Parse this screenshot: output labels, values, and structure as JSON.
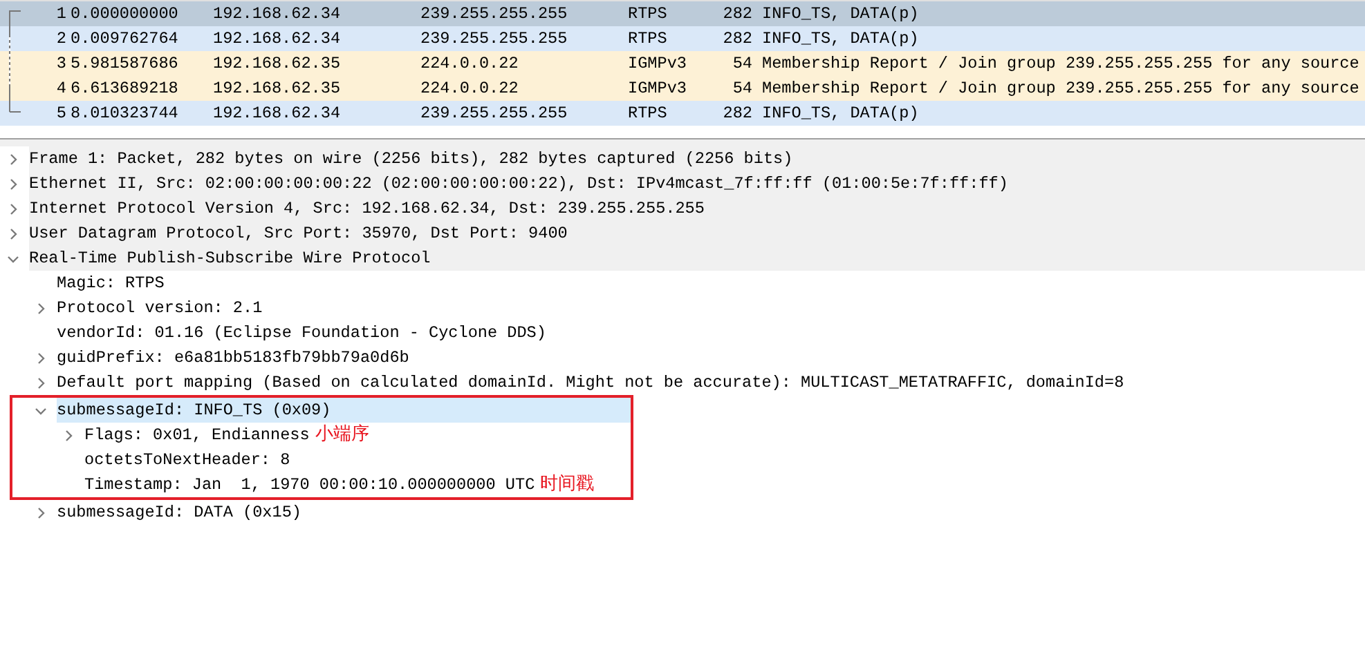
{
  "packet_list": {
    "rows": [
      {
        "no": "1",
        "time": "0.000000000",
        "source": "192.168.62.34",
        "destination": "239.255.255.255",
        "protocol": "RTPS",
        "length": "282",
        "info": "INFO_TS, DATA(p)",
        "selected": true
      },
      {
        "no": "2",
        "time": "0.009762764",
        "source": "192.168.62.34",
        "destination": "239.255.255.255",
        "protocol": "RTPS",
        "length": "282",
        "info": "INFO_TS, DATA(p)",
        "selected": false,
        "color": "#dae8f8"
      },
      {
        "no": "3",
        "time": "5.981587686",
        "source": "192.168.62.35",
        "destination": "224.0.0.22",
        "protocol": "IGMPv3",
        "length": "54",
        "info": "Membership Report / Join group 239.255.255.255 for any source",
        "selected": false,
        "color": "#fdf1d6"
      },
      {
        "no": "4",
        "time": "6.613689218",
        "source": "192.168.62.35",
        "destination": "224.0.0.22",
        "protocol": "IGMPv3",
        "length": "54",
        "info": "Membership Report / Join group 239.255.255.255 for any source",
        "selected": false,
        "color": "#fdf1d6"
      },
      {
        "no": "5",
        "time": "8.010323744",
        "source": "192.168.62.34",
        "destination": "239.255.255.255",
        "protocol": "RTPS",
        "length": "282",
        "info": "INFO_TS, DATA(p)",
        "selected": false,
        "color": "#dae8f8"
      }
    ]
  },
  "details": {
    "tree": [
      {
        "kind": "branch",
        "text": "Frame 1: Packet, 282 bytes on wire (2256 bits), 282 bytes captured (2256 bits)",
        "expanded": false,
        "selected": false
      },
      {
        "kind": "branch",
        "text": "Ethernet II, Src: 02:00:00:00:00:22 (02:00:00:00:00:22), Dst: IPv4mcast_7f:ff:ff (01:00:5e:7f:ff:ff)",
        "expanded": false,
        "selected": false
      },
      {
        "kind": "branch",
        "text": "Internet Protocol Version 4, Src: 192.168.62.34, Dst: 239.255.255.255",
        "expanded": false,
        "selected": false
      },
      {
        "kind": "branch",
        "text": "User Datagram Protocol, Src Port: 35970, Dst Port: 9400",
        "expanded": false,
        "selected": false
      },
      {
        "kind": "branch",
        "text": "Real-Time Publish-Subscribe Wire Protocol",
        "expanded": true,
        "selected": false,
        "children": [
          {
            "kind": "leaf",
            "text": "Magic: RTPS",
            "selected": false
          },
          {
            "kind": "branch",
            "text": "Protocol version: 2.1",
            "expanded": false,
            "selected": false
          },
          {
            "kind": "leaf",
            "text": "vendorId: 01.16 (Eclipse Foundation - Cyclone DDS)",
            "selected": false
          },
          {
            "kind": "branch",
            "text": "guidPrefix: e6a81bb5183fb79bb79a0d6b",
            "expanded": false,
            "selected": false
          },
          {
            "kind": "branch",
            "text": "Default port mapping (Based on calculated domainId. Might not be accurate): MULTICAST_METATRAFFIC, domainId=8",
            "expanded": false,
            "selected": false
          },
          {
            "kind": "branch",
            "text": "submessageId: INFO_TS (0x09)",
            "expanded": true,
            "selected": true,
            "boxed": true,
            "children": [
              {
                "kind": "branch",
                "text": "Flags: 0x01, Endianness",
                "expanded": false,
                "selected": false,
                "note": "小端序"
              },
              {
                "kind": "leaf",
                "text": "octetsToNextHeader: 8",
                "selected": false
              },
              {
                "kind": "leaf",
                "text": "Timestamp: Jan  1, 1970 00:00:10.000000000 UTC",
                "selected": false,
                "note": "时间戳"
              }
            ]
          },
          {
            "kind": "branch",
            "text": "submessageId: DATA (0x15)",
            "expanded": false,
            "selected": false
          }
        ]
      }
    ]
  }
}
